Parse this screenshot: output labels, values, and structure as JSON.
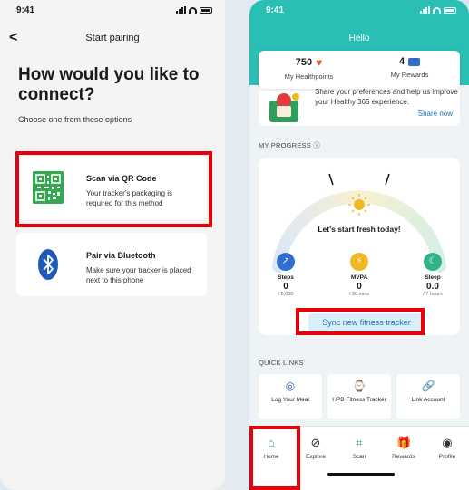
{
  "left_screen": {
    "status_time": "9:41",
    "nav": {
      "back": "<",
      "title": "Start pairing"
    },
    "headline": "How would you like to connect?",
    "subline": "Choose one from these options",
    "options": [
      {
        "title": "Scan via QR Code",
        "desc": "Your tracker's packaging is required for this method",
        "icon": "qr-code-icon"
      },
      {
        "title": "Pair via Bluetooth",
        "desc": "Make sure your tracker is placed next to this phone",
        "icon": "bluetooth-icon"
      }
    ]
  },
  "right_screen": {
    "status_time": "9:41",
    "greeting": "Hello",
    "stats": [
      {
        "value": "750",
        "label": "My Healthpoints",
        "icon": "heart-icon"
      },
      {
        "value": "4",
        "label": "My Rewards",
        "icon": "ticket-icon"
      }
    ],
    "promo": {
      "text": "Share your preferences and help us improve your Healthy 365 experience.",
      "link": "Share now"
    },
    "progress_label": "MY PROGRESS ⓘ",
    "fresh_text": "Let's start fresh today!",
    "metrics": [
      {
        "label": "Steps",
        "value": "0",
        "goal": "/ 5,000",
        "color": "#2f6fd0"
      },
      {
        "label": "MVPA",
        "value": "0",
        "goal": "/ 30 mins",
        "color": "#f2b724"
      },
      {
        "label": "Sleep",
        "value": "0.0",
        "goal": "/ 7 hours",
        "color": "#2fb38a"
      }
    ],
    "sync_button": "Sync new fitness tracker",
    "quick_links_label": "QUICK LINKS",
    "quick_links": [
      {
        "label": "Log Your Meal",
        "icon": "meal-icon"
      },
      {
        "label": "HPB Fitness Tracker",
        "icon": "watch-icon"
      },
      {
        "label": "Link Account",
        "icon": "link-icon"
      }
    ],
    "tabs": [
      {
        "label": "Home",
        "icon": "home-icon",
        "active": true
      },
      {
        "label": "Explore",
        "icon": "compass-icon"
      },
      {
        "label": "Scan",
        "icon": "scan-icon"
      },
      {
        "label": "Rewards",
        "icon": "gift-icon"
      },
      {
        "label": "Profile",
        "icon": "profile-icon"
      }
    ]
  },
  "colors": {
    "teal": "#2abfb5",
    "highlight": "#e8000b",
    "link": "#1a73b6",
    "qr_green": "#34a853",
    "bluetooth_blue": "#1e5bb8"
  }
}
